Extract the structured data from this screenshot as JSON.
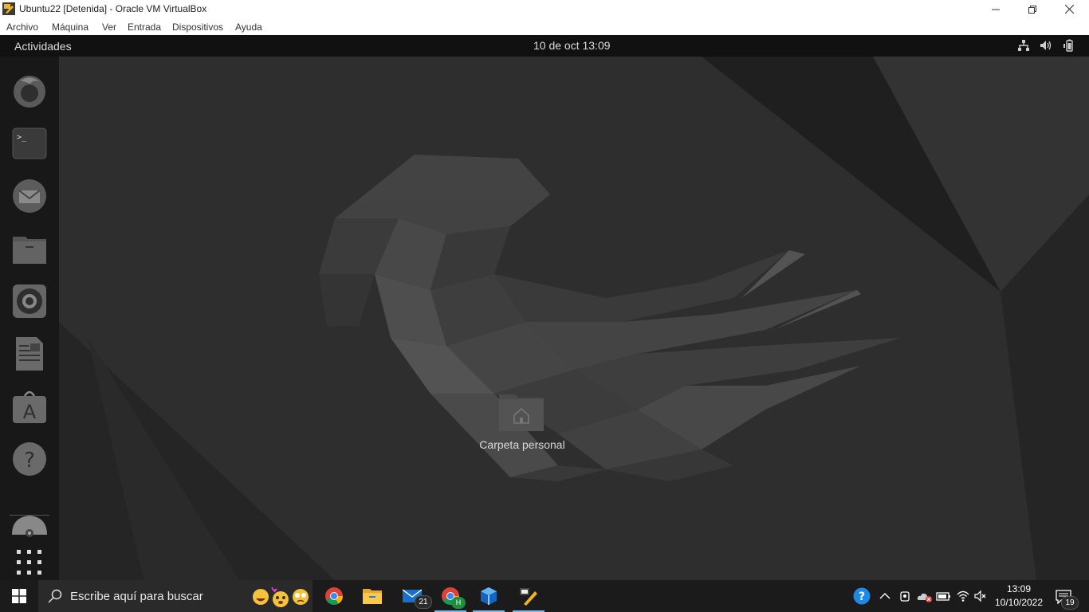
{
  "window": {
    "title": "Ubuntu22 [Detenida] - Oracle VM VirtualBox",
    "menu": [
      "Archivo",
      "Máquina",
      "Ver",
      "Entrada",
      "Dispositivos",
      "Ayuda"
    ]
  },
  "ubuntu": {
    "topbar": {
      "activities": "Actividades",
      "clock": "10 de oct  13:09",
      "tray_icons": [
        "network-icon",
        "volume-icon",
        "battery-icon"
      ]
    },
    "dock": {
      "items": [
        "firefox-icon",
        "terminal-icon",
        "thunderbird-icon",
        "files-icon",
        "rhythmbox-icon",
        "libreoffice-writer-icon",
        "software-center-icon",
        "help-icon",
        "dvd-drive-icon",
        "show-apps-icon"
      ]
    },
    "desktop": {
      "home_folder_label": "Carpeta personal"
    }
  },
  "taskbar": {
    "search_placeholder": "Escribe aquí para buscar",
    "apps": [
      "chrome-icon",
      "file-explorer-icon",
      "mail-icon",
      "chrome-profile-icon",
      "virtualbox-icon",
      "virtualbox-vm-icon"
    ],
    "mail_badge": "21",
    "chrome_profile_badge": "H",
    "time": "13:09",
    "date": "10/10/2022",
    "notifications_count": "19"
  },
  "colors": {
    "accent_underline": "#76b9ed",
    "taskbar_bg": "#1b1b1b",
    "guest_bg": "#2b2b2b"
  }
}
